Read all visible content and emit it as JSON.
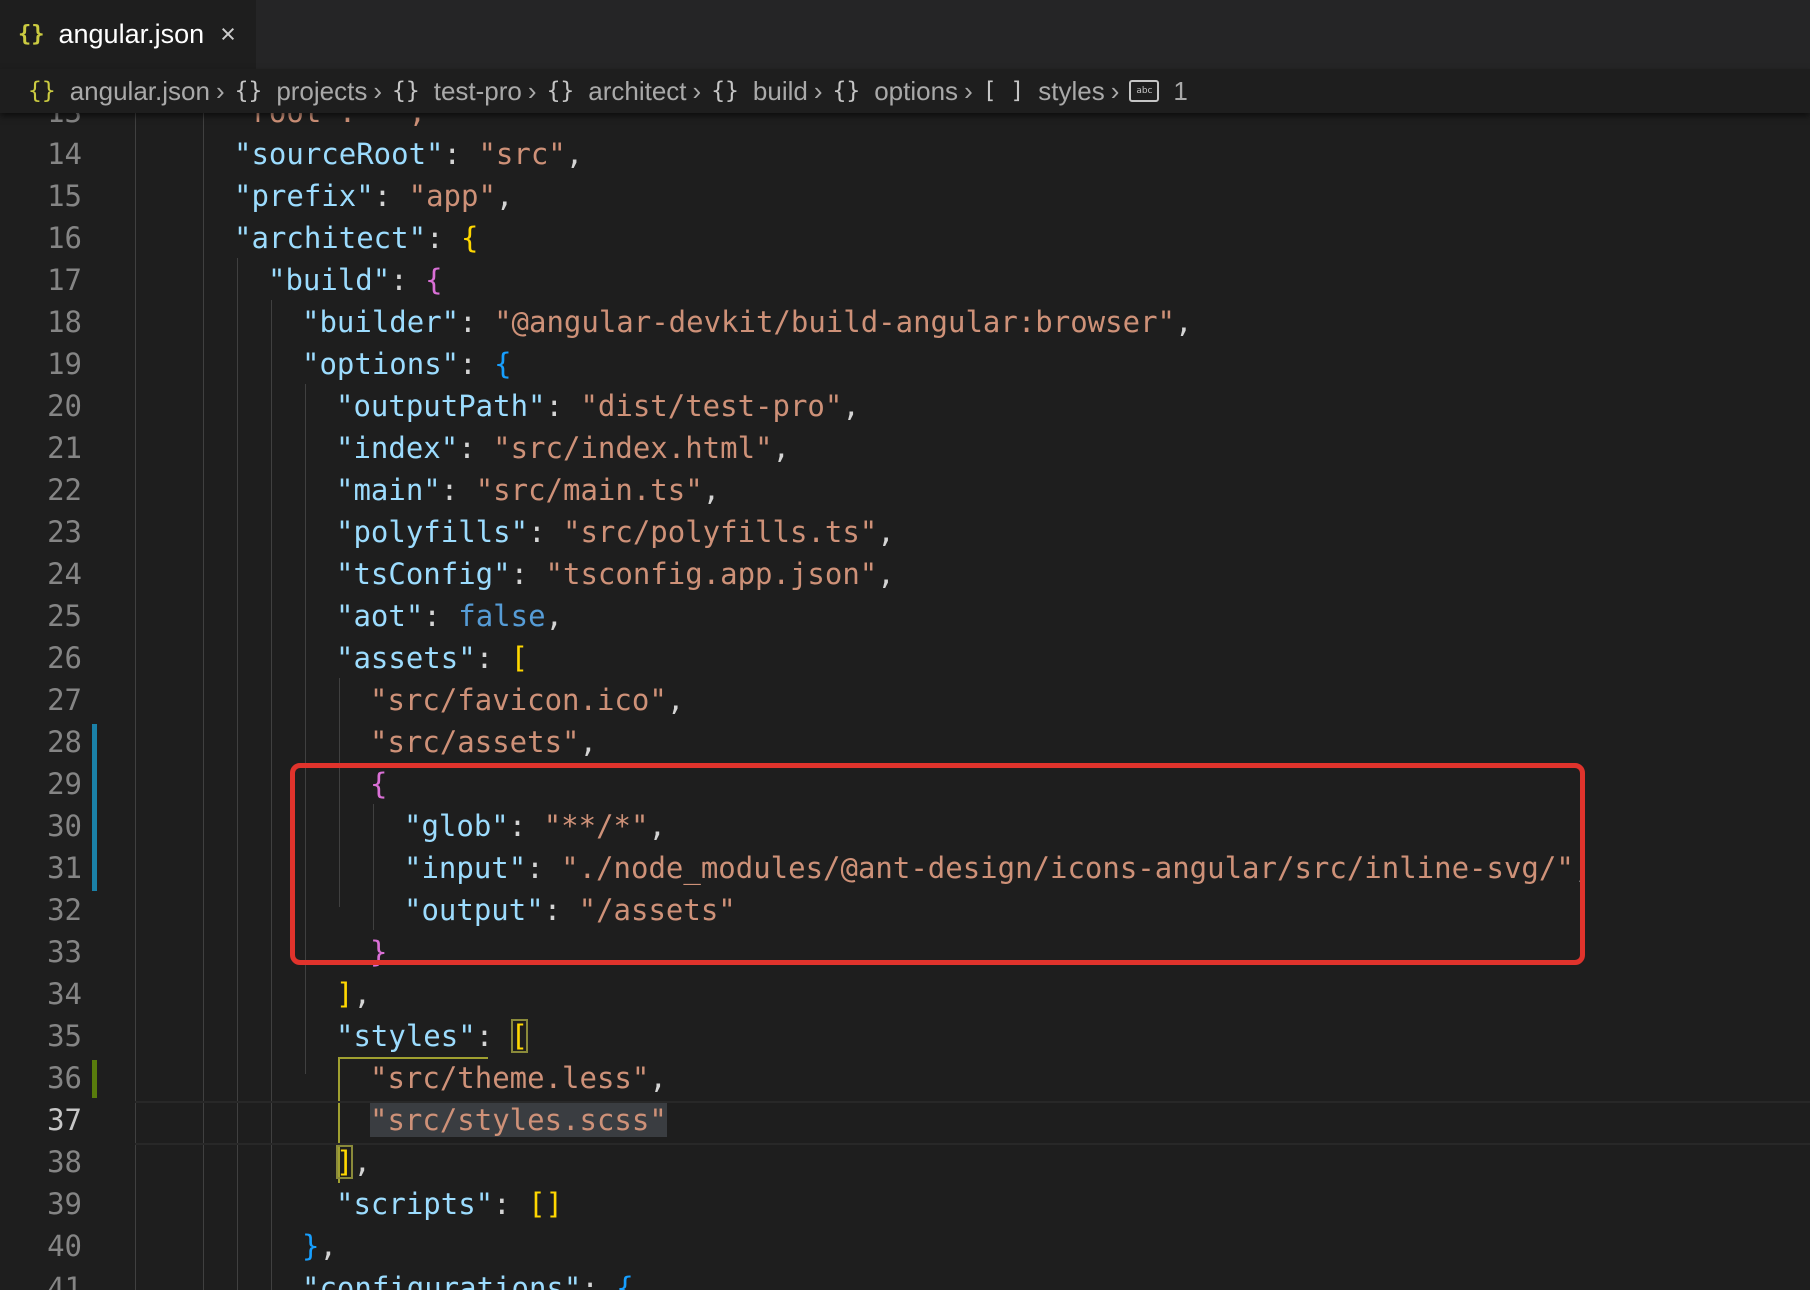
{
  "tab": {
    "icon": "{}",
    "name": "angular.json",
    "close": "×"
  },
  "breadcrumbs": [
    {
      "icon": "{}",
      "label": "angular.json"
    },
    {
      "icon": "{}",
      "label": "projects"
    },
    {
      "icon": "{}",
      "label": "test-pro"
    },
    {
      "icon": "{}",
      "label": "architect"
    },
    {
      "icon": "{}",
      "label": "build"
    },
    {
      "icon": "{}",
      "label": "options"
    },
    {
      "icon": "[ ]",
      "label": "styles"
    },
    {
      "icon": "abc",
      "label": "1"
    }
  ],
  "lines": [
    {
      "n": "13",
      "indent": 0,
      "tokens": [
        [
          "s",
          "\"root\": \"\","
        ]
      ]
    },
    {
      "n": "14",
      "indent": 0,
      "tokens": [
        [
          "k",
          "\"sourceRoot\""
        ],
        [
          "p",
          ": "
        ],
        [
          "s",
          "\"src\""
        ],
        [
          "p",
          ","
        ]
      ]
    },
    {
      "n": "15",
      "indent": 0,
      "tokens": [
        [
          "k",
          "\"prefix\""
        ],
        [
          "p",
          ": "
        ],
        [
          "s",
          "\"app\""
        ],
        [
          "p",
          ","
        ]
      ]
    },
    {
      "n": "16",
      "indent": 0,
      "tokens": [
        [
          "k",
          "\"architect\""
        ],
        [
          "p",
          ": "
        ],
        [
          "b1",
          "{"
        ]
      ]
    },
    {
      "n": "17",
      "indent": 1,
      "tokens": [
        [
          "k",
          "\"build\""
        ],
        [
          "p",
          ": "
        ],
        [
          "b2",
          "{"
        ]
      ]
    },
    {
      "n": "18",
      "indent": 2,
      "tokens": [
        [
          "k",
          "\"builder\""
        ],
        [
          "p",
          ": "
        ],
        [
          "s",
          "\"@angular-devkit/build-angular:browser\""
        ],
        [
          "p",
          ","
        ]
      ]
    },
    {
      "n": "19",
      "indent": 2,
      "tokens": [
        [
          "k",
          "\"options\""
        ],
        [
          "p",
          ": "
        ],
        [
          "b3",
          "{"
        ]
      ]
    },
    {
      "n": "20",
      "indent": 3,
      "tokens": [
        [
          "k",
          "\"outputPath\""
        ],
        [
          "p",
          ": "
        ],
        [
          "s",
          "\"dist/test-pro\""
        ],
        [
          "p",
          ","
        ]
      ]
    },
    {
      "n": "21",
      "indent": 3,
      "tokens": [
        [
          "k",
          "\"index\""
        ],
        [
          "p",
          ": "
        ],
        [
          "s",
          "\"src/index.html\""
        ],
        [
          "p",
          ","
        ]
      ]
    },
    {
      "n": "22",
      "indent": 3,
      "tokens": [
        [
          "k",
          "\"main\""
        ],
        [
          "p",
          ": "
        ],
        [
          "s",
          "\"src/main.ts\""
        ],
        [
          "p",
          ","
        ]
      ]
    },
    {
      "n": "23",
      "indent": 3,
      "tokens": [
        [
          "k",
          "\"polyfills\""
        ],
        [
          "p",
          ": "
        ],
        [
          "s",
          "\"src/polyfills.ts\""
        ],
        [
          "p",
          ","
        ]
      ]
    },
    {
      "n": "24",
      "indent": 3,
      "tokens": [
        [
          "k",
          "\"tsConfig\""
        ],
        [
          "p",
          ": "
        ],
        [
          "s",
          "\"tsconfig.app.json\""
        ],
        [
          "p",
          ","
        ]
      ]
    },
    {
      "n": "25",
      "indent": 3,
      "tokens": [
        [
          "k",
          "\"aot\""
        ],
        [
          "p",
          ": "
        ],
        [
          "kw",
          "false"
        ],
        [
          "p",
          ","
        ]
      ]
    },
    {
      "n": "26",
      "indent": 3,
      "tokens": [
        [
          "k",
          "\"assets\""
        ],
        [
          "p",
          ": "
        ],
        [
          "b1",
          "["
        ]
      ]
    },
    {
      "n": "27",
      "indent": 4,
      "tokens": [
        [
          "s",
          "\"src/favicon.ico\""
        ],
        [
          "p",
          ","
        ]
      ]
    },
    {
      "n": "28",
      "indent": 4,
      "tokens": [
        [
          "s",
          "\"src/assets\""
        ],
        [
          "p",
          ","
        ]
      ]
    },
    {
      "n": "29",
      "indent": 4,
      "tokens": [
        [
          "b2",
          "{"
        ]
      ]
    },
    {
      "n": "30",
      "indent": 5,
      "tokens": [
        [
          "k",
          "\"glob\""
        ],
        [
          "p",
          ": "
        ],
        [
          "s",
          "\"**/*\""
        ],
        [
          "p",
          ","
        ]
      ]
    },
    {
      "n": "31",
      "indent": 5,
      "tokens": [
        [
          "k",
          "\"input\""
        ],
        [
          "p",
          ": "
        ],
        [
          "s",
          "\"./node_modules/@ant-design/icons-angular/src/inline-svg/\""
        ],
        [
          "p",
          ","
        ]
      ]
    },
    {
      "n": "32",
      "indent": 5,
      "tokens": [
        [
          "k",
          "\"output\""
        ],
        [
          "p",
          ": "
        ],
        [
          "s",
          "\"/assets\""
        ]
      ]
    },
    {
      "n": "33",
      "indent": 4,
      "tokens": [
        [
          "b2",
          "}"
        ]
      ]
    },
    {
      "n": "34",
      "indent": 3,
      "tokens": [
        [
          "b1",
          "]"
        ],
        [
          "p",
          ","
        ]
      ]
    },
    {
      "n": "35",
      "indent": 3,
      "tokens": [
        [
          "k",
          "\"styles\""
        ],
        [
          "p",
          ": "
        ],
        [
          "b1m",
          "["
        ]
      ]
    },
    {
      "n": "36",
      "indent": 4,
      "tokens": [
        [
          "s",
          "\"src/theme.less\""
        ],
        [
          "p",
          ","
        ]
      ]
    },
    {
      "n": "37",
      "indent": 4,
      "tokens": [
        [
          "ssel",
          "\"src/styles.scss\""
        ]
      ]
    },
    {
      "n": "38",
      "indent": 3,
      "tokens": [
        [
          "b1m",
          "]"
        ],
        [
          "p",
          ","
        ]
      ]
    },
    {
      "n": "39",
      "indent": 3,
      "tokens": [
        [
          "k",
          "\"scripts\""
        ],
        [
          "p",
          ": "
        ],
        [
          "b1",
          "[]"
        ]
      ]
    },
    {
      "n": "40",
      "indent": 2,
      "tokens": [
        [
          "b3",
          "}"
        ],
        [
          "p",
          ","
        ]
      ]
    },
    {
      "n": "41",
      "indent": 2,
      "tokens": [
        [
          "k",
          "\"configurations\""
        ],
        [
          "p",
          ": "
        ],
        [
          "b3",
          "{"
        ]
      ]
    }
  ],
  "colors": {
    "background": "#1e1e1e",
    "key": "#9cdcfe",
    "string": "#ce9178",
    "keyword": "#569cd6",
    "highlight_box": "#e0332c"
  }
}
